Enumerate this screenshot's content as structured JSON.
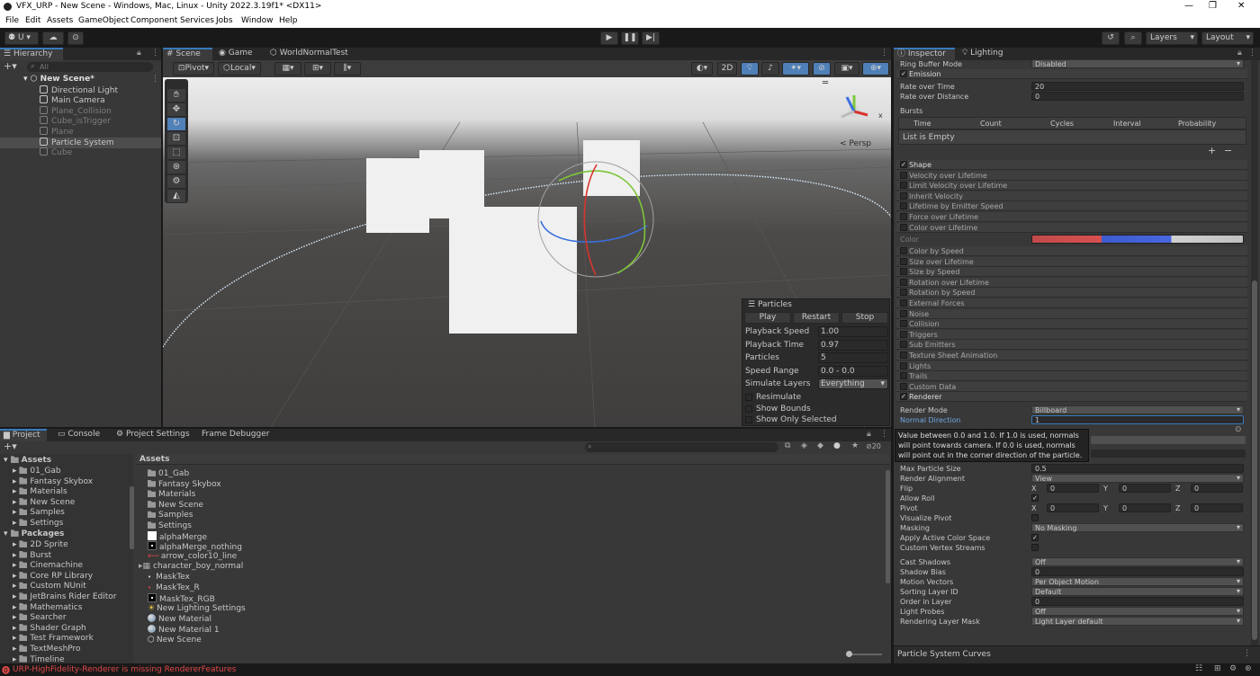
{
  "window": {
    "title": "VFX_URP - New Scene - Windows, Mac, Linux - Unity 2022.3.19f1* <DX11>"
  },
  "menu": [
    "File",
    "Edit",
    "Assets",
    "GameObject",
    "Component",
    "Services",
    "Jobs",
    "Window",
    "Help"
  ],
  "toolbar": {
    "account": "U",
    "layers": "Layers",
    "layout": "Layout"
  },
  "hierarchy": {
    "tab": "Hierarchy",
    "search": "All",
    "scene": "New Scene*",
    "items": [
      {
        "label": "Directional Light",
        "inactive": false
      },
      {
        "label": "Main Camera",
        "inactive": false
      },
      {
        "label": "Plane_Collision",
        "inactive": true
      },
      {
        "label": "Cube_isTrigger",
        "inactive": true
      },
      {
        "label": "Plane",
        "inactive": true
      },
      {
        "label": "Particle System",
        "inactive": false
      },
      {
        "label": "Cube",
        "inactive": true
      }
    ]
  },
  "scene": {
    "tabs": [
      "Scene",
      "Game",
      "WorldNormalTest"
    ],
    "pivot": "Pivot",
    "local": "Local",
    "mode2d": "2D",
    "persp": "< Persp",
    "gizmo_axis": "x"
  },
  "particles": {
    "title": "Particles",
    "play": "Play",
    "restart": "Restart",
    "stop": "Stop",
    "fields": [
      {
        "label": "Playback Speed",
        "value": "1.00"
      },
      {
        "label": "Playback Time",
        "value": "0.97"
      },
      {
        "label": "Particles",
        "value": "5"
      },
      {
        "label": "Speed Range",
        "value": "0.0 - 0.0"
      },
      {
        "label": "Simulate Layers",
        "value": "Everything"
      }
    ],
    "checks": [
      "Resimulate",
      "Show Bounds",
      "Show Only Selected"
    ]
  },
  "inspector": {
    "tabs": [
      "Inspector",
      "Lighting"
    ],
    "ring_buffer": {
      "label": "Ring Buffer Mode",
      "value": "Disabled"
    },
    "emission": "Emission",
    "rate_time": {
      "label": "Rate over Time",
      "value": "20"
    },
    "rate_distance": {
      "label": "Rate over Distance",
      "value": "0"
    },
    "bursts": "Bursts",
    "burst_cols": [
      "Time",
      "Count",
      "Cycles",
      "Interval",
      "Probability"
    ],
    "list_empty": "List is Empty",
    "modules_a": [
      {
        "label": "Shape",
        "on": true
      },
      {
        "label": "Velocity over Lifetime",
        "on": false
      },
      {
        "label": "Limit Velocity over Lifetime",
        "on": false
      },
      {
        "label": "Inherit Velocity",
        "on": false
      },
      {
        "label": "Lifetime by Emitter Speed",
        "on": false
      },
      {
        "label": "Force over Lifetime",
        "on": false
      },
      {
        "label": "Color over Lifetime",
        "on": false
      }
    ],
    "color_label": "Color",
    "modules_b": [
      {
        "label": "Color by Speed",
        "on": false
      },
      {
        "label": "Size over Lifetime",
        "on": false
      },
      {
        "label": "Size by Speed",
        "on": false
      },
      {
        "label": "Rotation over Lifetime",
        "on": false
      },
      {
        "label": "Rotation by Speed",
        "on": false
      },
      {
        "label": "External Forces",
        "on": false
      },
      {
        "label": "Noise",
        "on": false
      },
      {
        "label": "Collision",
        "on": false
      },
      {
        "label": "Triggers",
        "on": false
      },
      {
        "label": "Sub Emitters",
        "on": false
      },
      {
        "label": "Texture Sheet Animation",
        "on": false
      },
      {
        "label": "Lights",
        "on": false
      },
      {
        "label": "Trails",
        "on": false
      },
      {
        "label": "Custom Data",
        "on": false
      },
      {
        "label": "Renderer",
        "on": true
      }
    ],
    "render_mode": {
      "label": "Render Mode",
      "value": "Billboard"
    },
    "normal_direction": {
      "label": "Normal Direction",
      "value": "1"
    },
    "tooltip": "Value between 0.0 and 1.0. If 1.0 is used, normals will point towards camera. If 0.0 is used, normals will point out in the corner direction of the particle.",
    "max_particle_size": {
      "label": "Max Particle Size",
      "value": "0.5"
    },
    "render_alignment": {
      "label": "Render Alignment",
      "value": "View"
    },
    "flip": {
      "label": "Flip",
      "x": "0",
      "y": "0",
      "z": "0"
    },
    "allow_roll": "Allow Roll",
    "pivot": {
      "label": "Pivot",
      "x": "0",
      "y": "0",
      "z": "0"
    },
    "visualize_pivot": "Visualize Pivot",
    "masking": {
      "label": "Masking",
      "value": "No Masking"
    },
    "apply_color_space": "Apply Active Color Space",
    "custom_streams": "Custom Vertex Streams",
    "cast_shadows": {
      "label": "Cast Shadows",
      "value": "Off"
    },
    "shadow_bias": {
      "label": "Shadow Bias",
      "value": "0"
    },
    "motion_vectors": {
      "label": "Motion Vectors",
      "value": "Per Object Motion"
    },
    "sorting_layer": {
      "label": "Sorting Layer ID",
      "value": "Default"
    },
    "order_in_layer": {
      "label": "Order in Layer",
      "value": "0"
    },
    "light_probes": {
      "label": "Light Probes",
      "value": "Off"
    },
    "rendering_layer": {
      "label": "Rendering Layer Mask",
      "value": "Light Layer default"
    },
    "curves": "Particle System Curves",
    "axis_x": "X",
    "axis_y": "Y",
    "axis_z": "Z"
  },
  "project": {
    "tabs": [
      "Project",
      "Console",
      "Project Settings",
      "Frame Debugger"
    ],
    "hidden_count": "20",
    "tree_assets": "Assets",
    "tree_asset_children": [
      "01_Gab",
      "Fantasy Skybox",
      "Materials",
      "New Scene",
      "Samples",
      "Settings"
    ],
    "tree_packages": "Packages",
    "tree_package_children": [
      "2D Sprite",
      "Burst",
      "Cinemachine",
      "Core RP Library",
      "Custom NUnit",
      "JetBrains Rider Editor",
      "Mathematics",
      "Searcher",
      "Shader Graph",
      "Test Framework",
      "TextMeshPro",
      "Timeline"
    ],
    "breadcrumb": "Assets",
    "items": [
      {
        "label": "01_Gab",
        "icon": "folder"
      },
      {
        "label": "Fantasy Skybox",
        "icon": "folder"
      },
      {
        "label": "Materials",
        "icon": "folder"
      },
      {
        "label": "New Scene",
        "icon": "folder"
      },
      {
        "label": "Samples",
        "icon": "folder"
      },
      {
        "label": "Settings",
        "icon": "folder"
      },
      {
        "label": "alphaMerge",
        "icon": "texture-white"
      },
      {
        "label": "alphaMerge_nothing",
        "icon": "texture-dark"
      },
      {
        "label": "arrow_color10_line",
        "icon": "texture-arrow"
      },
      {
        "label": "character_boy_normal",
        "icon": "model"
      },
      {
        "label": "MaskTex",
        "icon": "texture-dot"
      },
      {
        "label": "MaskTex_R",
        "icon": "texture-dot-red"
      },
      {
        "label": "MaskTex_RGB",
        "icon": "texture-dark"
      },
      {
        "label": "New Lighting Settings",
        "icon": "lighting"
      },
      {
        "label": "New Material",
        "icon": "material"
      },
      {
        "label": "New Material 1",
        "icon": "material"
      },
      {
        "label": "New Scene",
        "icon": "scene"
      }
    ]
  },
  "status": {
    "message": "URP-HighFidelity-Renderer is missing RendererFeatures"
  },
  "colors": {
    "accent": "#3a79bb",
    "error": "#e04848",
    "panel": "#383838",
    "sceneSky": "#e9e9e9"
  }
}
